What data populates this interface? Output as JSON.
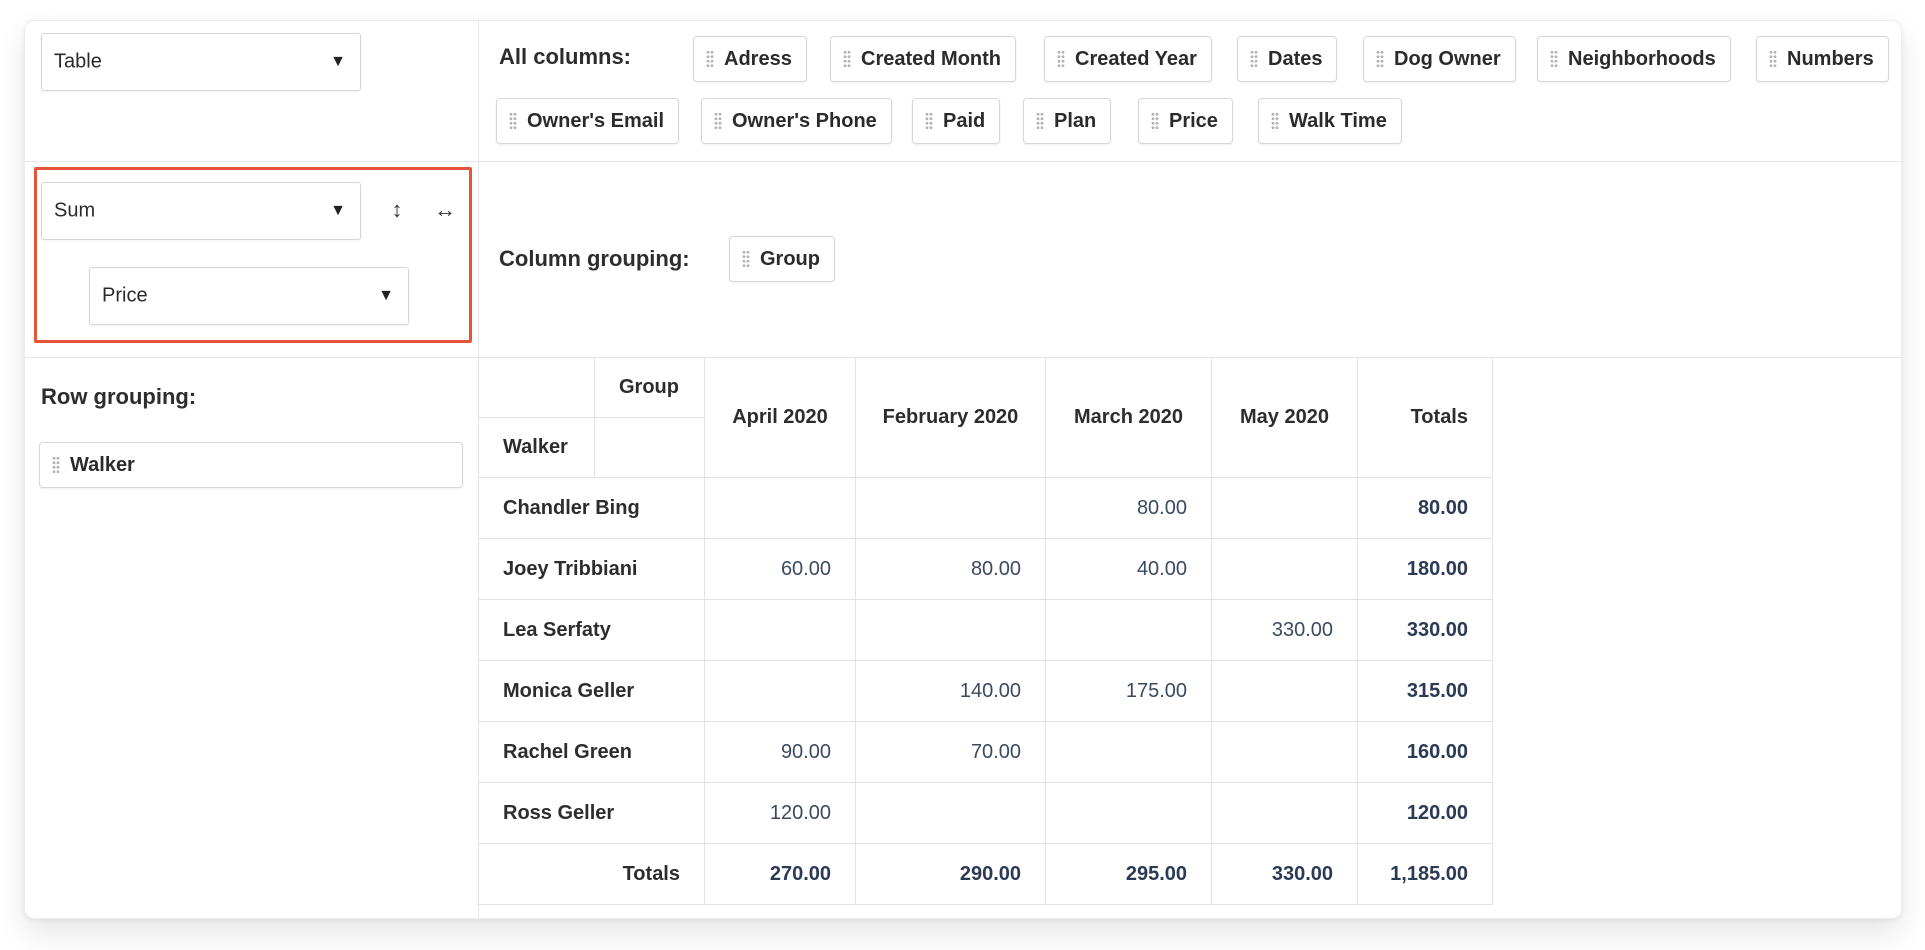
{
  "renderer": {
    "value": "Table"
  },
  "aggregator": {
    "function": "Sum",
    "attribute": "Price",
    "row_order_icon": "↕",
    "col_order_icon": "↔"
  },
  "all_columns": {
    "label": "All columns:",
    "items": [
      "Adress",
      "Created Month",
      "Created Year",
      "Dates",
      "Dog Owner",
      "Neighborhoods",
      "Numbers",
      "Owner's Email",
      "Owner's Phone",
      "Paid",
      "Plan",
      "Price",
      "Walk Time"
    ]
  },
  "column_grouping": {
    "label": "Column grouping:",
    "items": [
      "Group"
    ]
  },
  "row_grouping": {
    "label": "Row grouping:",
    "items": [
      "Walker"
    ]
  },
  "table": {
    "col_attr": "Group",
    "row_attr": "Walker",
    "columns": [
      "April 2020",
      "February 2020",
      "March 2020",
      "May 2020",
      "Totals"
    ],
    "rows": [
      {
        "label": "Chandler Bing",
        "cells": [
          "",
          "",
          "80.00",
          "",
          "80.00"
        ]
      },
      {
        "label": "Joey Tribbiani",
        "cells": [
          "60.00",
          "80.00",
          "40.00",
          "",
          "180.00"
        ]
      },
      {
        "label": "Lea Serfaty",
        "cells": [
          "",
          "",
          "",
          "330.00",
          "330.00"
        ]
      },
      {
        "label": "Monica Geller",
        "cells": [
          "",
          "140.00",
          "175.00",
          "",
          "315.00"
        ]
      },
      {
        "label": "Rachel Green",
        "cells": [
          "90.00",
          "70.00",
          "",
          "",
          "160.00"
        ]
      },
      {
        "label": "Ross Geller",
        "cells": [
          "120.00",
          "",
          "",
          "",
          "120.00"
        ]
      }
    ],
    "totals": {
      "label": "Totals",
      "cells": [
        "270.00",
        "290.00",
        "295.00",
        "330.00",
        "1,185.00"
      ]
    }
  },
  "colors": {
    "highlight": "#e55338",
    "value_text": "#3a4a60",
    "total_text": "#2b3a55"
  },
  "icons": {
    "caret": "caret-down-icon",
    "grip": "drag-grip-icon"
  }
}
